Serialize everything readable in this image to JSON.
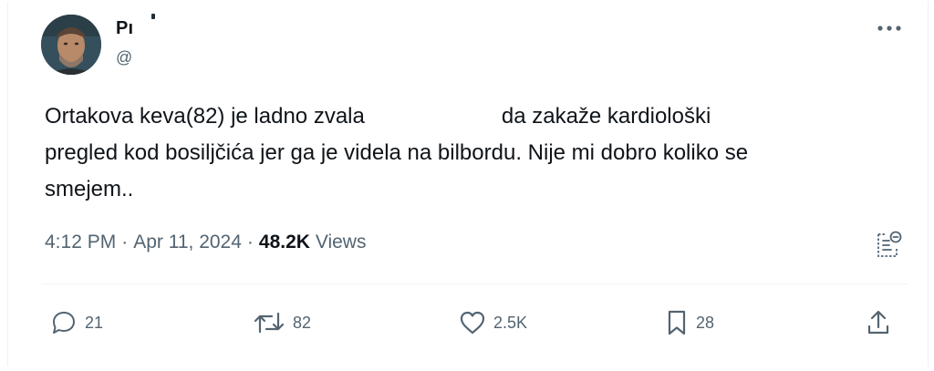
{
  "author": {
    "name": "Pı",
    "handle": "@"
  },
  "tweet": {
    "text_line1_a": "Ortakova keva(82) je ladno zvala",
    "text_line1_b": "da zakaže kardiološki",
    "text_line2": "pregled kod bosiljčića jer ga je videla na bilbordu. Nije mi dobro koliko se",
    "text_line3": "smejem.."
  },
  "meta": {
    "time": "4:12 PM",
    "separator1": "·",
    "date": "Apr 11, 2024",
    "separator2": "·",
    "views_count": "48.2K",
    "views_label": "Views"
  },
  "actions": {
    "reply_count": "21",
    "retweet_count": "82",
    "like_count": "2.5K",
    "bookmark_count": "28"
  },
  "icons": {
    "more": "more-horizontal-icon",
    "analytics": "analytics-icon",
    "reply": "reply-icon",
    "retweet": "retweet-icon",
    "like": "heart-icon",
    "bookmark": "bookmark-icon",
    "share": "share-icon"
  },
  "colors": {
    "text_primary": "#0f1419",
    "text_secondary": "#536471",
    "divider": "#eff3f4"
  }
}
